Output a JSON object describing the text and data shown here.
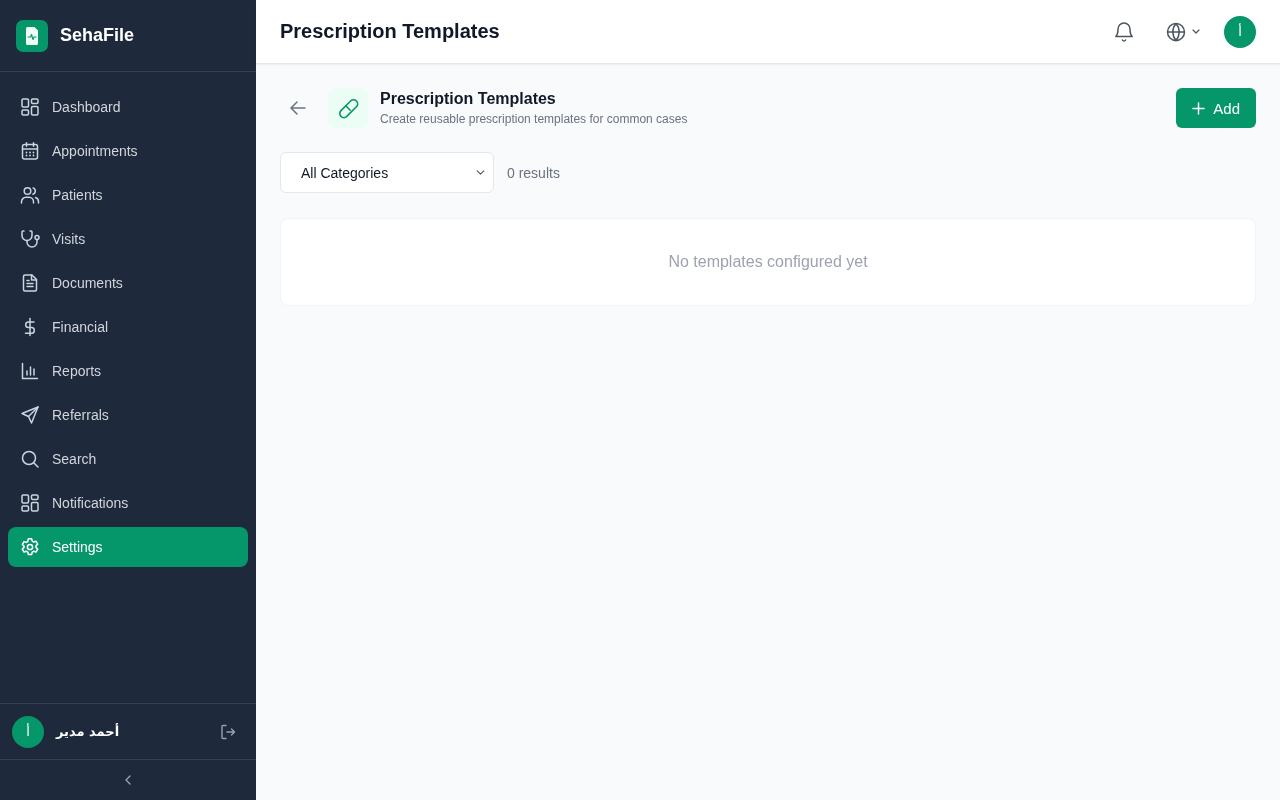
{
  "sidebar": {
    "brand": "SehaFile",
    "nav_items": [
      {
        "label": "Dashboard",
        "selected": false
      },
      {
        "label": "Appointments",
        "selected": false
      },
      {
        "label": "Patients",
        "selected": false
      },
      {
        "label": "Visits",
        "selected": false
      },
      {
        "label": "Documents",
        "selected": false
      },
      {
        "label": "Financial",
        "selected": false
      },
      {
        "label": "Reports",
        "selected": false
      },
      {
        "label": "Referrals",
        "selected": false
      },
      {
        "label": "Search",
        "selected": false
      },
      {
        "label": "Notifications",
        "selected": false
      },
      {
        "label": "Settings",
        "selected": true
      }
    ],
    "user": {
      "avatar_initial": "أ",
      "name": "أحمد مدير"
    }
  },
  "header": {
    "title": "Prescription Templates",
    "avatar_initial": "أ"
  },
  "page": {
    "title": "Prescription Templates",
    "subtitle": "Create reusable prescription templates for common cases",
    "add_button": "Add",
    "filter": {
      "value": "All Categories"
    },
    "result_count": "0 results",
    "empty_message": "No templates configured yet"
  }
}
